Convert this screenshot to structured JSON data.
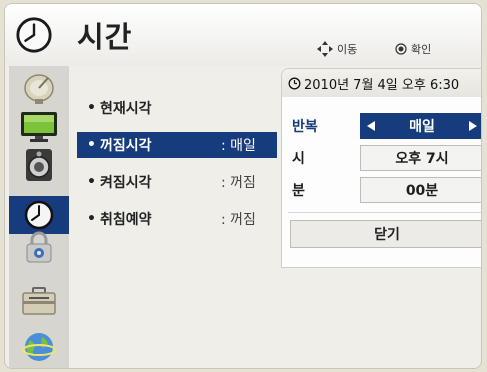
{
  "header": {
    "title": "시간",
    "title_icon": "clock-icon",
    "hint_move": "이동",
    "hint_ok": "확인"
  },
  "categories": [
    {
      "name": "satellite-icon",
      "active": false
    },
    {
      "name": "monitor-icon",
      "active": false
    },
    {
      "name": "speaker-icon",
      "active": false
    },
    {
      "name": "clock-icon",
      "active": true
    },
    {
      "name": "lock-icon",
      "active": false
    },
    {
      "name": "toolbox-icon",
      "active": false
    },
    {
      "name": "globe-icon",
      "active": false
    }
  ],
  "menu": {
    "items": [
      {
        "label": "현재시각",
        "value": ""
      },
      {
        "label": "꺼짐시각",
        "value": ": 매일",
        "selected": true
      },
      {
        "label": "켜짐시각",
        "value": ": 꺼짐"
      },
      {
        "label": "취침예약",
        "value": ": 꺼짐"
      }
    ]
  },
  "popup": {
    "datetime": "2010년 7월 4일 오후 6:30",
    "repeat_label": "반복",
    "repeat_value": "매일",
    "hour_label": "시",
    "hour_value": "오후 7시",
    "minute_label": "분",
    "minute_value": "00분",
    "close_label": "닫기"
  },
  "colors": {
    "accent": "#173c7d",
    "background": "#e6e2d3"
  }
}
